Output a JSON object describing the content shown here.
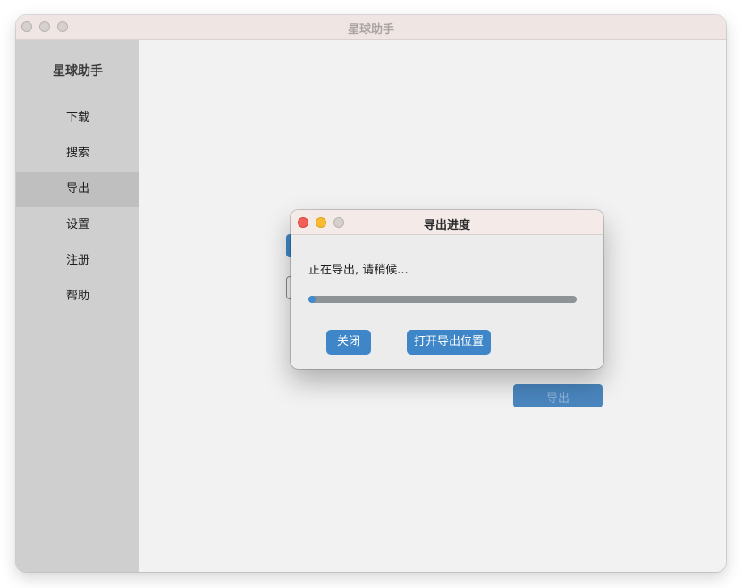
{
  "window": {
    "title": "星球助手"
  },
  "sidebar": {
    "title": "星球助手",
    "items": [
      {
        "label": "下载",
        "active": false
      },
      {
        "label": "搜索",
        "active": false
      },
      {
        "label": "导出",
        "active": true
      },
      {
        "label": "设置",
        "active": false
      },
      {
        "label": "注册",
        "active": false
      },
      {
        "label": "帮助",
        "active": false
      }
    ]
  },
  "background": {
    "export_button_label": "导出"
  },
  "dialog": {
    "title": "导出进度",
    "message": "正在导出, 请稍候...",
    "progress_percent": 2,
    "close_label": "关闭",
    "open_location_label": "打开导出位置"
  },
  "colors": {
    "accent": "#3e86c8",
    "traffic_red": "#f25f57",
    "traffic_yellow": "#f8bc2e",
    "traffic_inactive": "#d6d1cf"
  }
}
